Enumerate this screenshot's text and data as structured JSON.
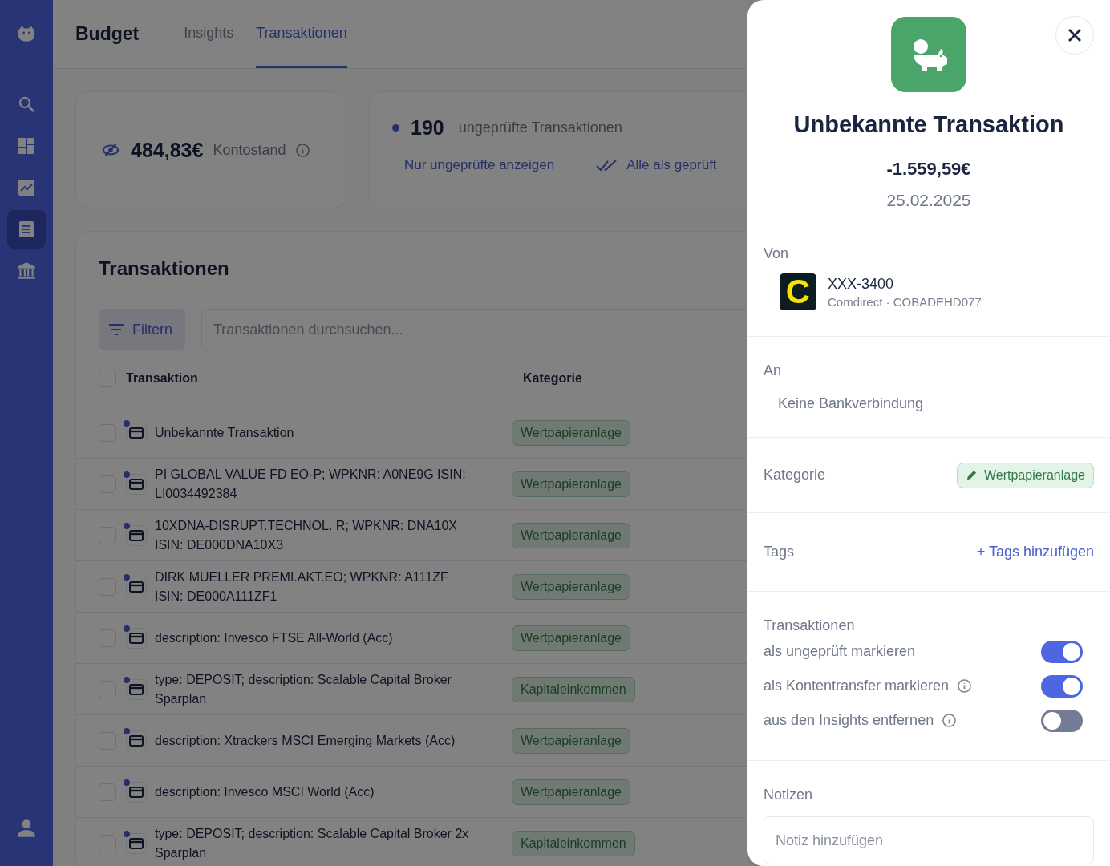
{
  "sidebar": {
    "items": [
      {
        "selected": false
      },
      {
        "selected": false
      },
      {
        "selected": false
      },
      {
        "selected": true
      },
      {
        "selected": false
      }
    ]
  },
  "header": {
    "title": "Budget",
    "tabs": [
      {
        "label": "Insights",
        "selected": false
      },
      {
        "label": "Transaktionen",
        "selected": true
      }
    ]
  },
  "balance": {
    "amount": "484,83€",
    "label": "Kontostand"
  },
  "review": {
    "count": "190",
    "label": "ungeprüfte Transaktionen",
    "actions": [
      "Nur ungeprüfte anzeigen",
      "Alle als geprüft"
    ]
  },
  "transactions": {
    "title": "Transaktionen",
    "filter": "Filtern",
    "search": {
      "placeholder": "Transaktionen durchsuchen..."
    },
    "columns": [
      "Transaktion",
      "Kategorie"
    ],
    "all_checked": false,
    "rows": [
      {
        "name": "Unbekannte Transaktion",
        "checked": false,
        "unreviewed": true,
        "category": "Wertpapieranlage"
      },
      {
        "name": "PI GLOBAL VALUE FD EO-P; WPKNR: A0NE9G ISIN: LI0034492384",
        "checked": false,
        "unreviewed": true,
        "category": "Wertpapieranlage"
      },
      {
        "name": "10XDNA-DISRUPT.TECHNOL. R; WPKNR: DNA10X ISIN: DE000DNA10X3",
        "checked": false,
        "unreviewed": true,
        "category": "Wertpapieranlage"
      },
      {
        "name": "DIRK MUELLER PREMI.AKT.EO; WPKNR: A111ZF ISIN: DE000A111ZF1",
        "checked": false,
        "unreviewed": true,
        "category": "Wertpapieranlage"
      },
      {
        "name": "description: Invesco FTSE All-World (Acc)",
        "checked": false,
        "unreviewed": true,
        "category": "Wertpapieranlage"
      },
      {
        "name": "type: DEPOSIT; description: Scalable Capital Broker Sparplan",
        "checked": false,
        "unreviewed": true,
        "category": "Kapitaleinkommen"
      },
      {
        "name": "description: Xtrackers MSCI Emerging Markets (Acc)",
        "checked": false,
        "unreviewed": true,
        "category": "Wertpapieranlage"
      },
      {
        "name": "description: Invesco MSCI World (Acc)",
        "checked": false,
        "unreviewed": true,
        "category": "Wertpapieranlage"
      },
      {
        "name": "type: DEPOSIT; description: Scalable Capital Broker 2x Sparplan",
        "checked": false,
        "unreviewed": true,
        "category": "Kapitaleinkommen"
      }
    ]
  },
  "detail": {
    "title": "Unbekannte Transaktion",
    "amount": "-1.559,59€",
    "date": "25.02.2025",
    "from": {
      "label": "Von",
      "account": "XXX-3400",
      "bank": "Comdirect · COBADEHD077",
      "logo_letter": "C"
    },
    "to": {
      "label": "An",
      "value": "Keine Bankverbindung"
    },
    "category": {
      "label": "Kategorie",
      "value": "Wertpapieranlage"
    },
    "tags": {
      "label": "Tags",
      "action": "+ Tags hinzufügen"
    },
    "toggles": {
      "title": "Transaktionen",
      "items": [
        {
          "label": "als ungeprüft markieren",
          "info": false,
          "on": true
        },
        {
          "label": "als Kontentransfer markieren",
          "info": true,
          "on": true
        },
        {
          "label": "aus den Insights entfernen",
          "info": true,
          "on": false
        }
      ]
    },
    "notes": {
      "label": "Notizen",
      "placeholder": "Notiz hinzufügen"
    }
  }
}
